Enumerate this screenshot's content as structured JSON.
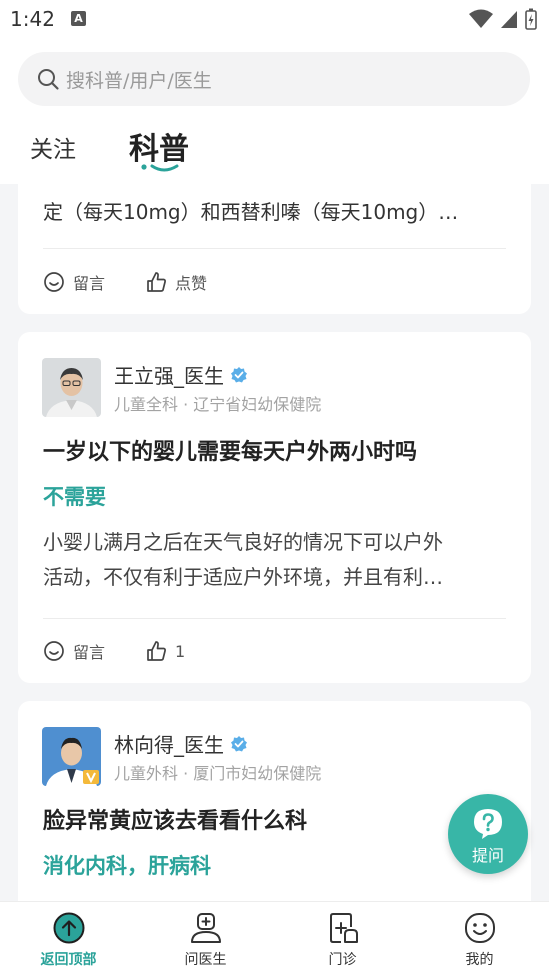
{
  "status": {
    "time": "1:42",
    "a_icon": "A"
  },
  "search": {
    "placeholder": "搜科普/用户/医生"
  },
  "tabs": {
    "follow": "关注",
    "kepu": "科普"
  },
  "card1": {
    "text": "定（每天10mg）和西替利嗪（每天10mg）…",
    "comment_label": "留言",
    "like_label": "点赞"
  },
  "card2": {
    "doctor_name": "王立强_医生",
    "department": "儿童全科 · 辽宁省妇幼保健院",
    "title": "一岁以下的婴儿需要每天户外两小时吗",
    "answer": "不需要",
    "excerpt_line1": "小婴儿满月之后在天气良好的情况下可以户外",
    "excerpt_line2": "活动，不仅有利于适应户外环境，并且有利…",
    "comment_label": "留言",
    "like_count": "1"
  },
  "card3": {
    "doctor_name": "林向得_医生",
    "department": "儿童外科 · 厦门市妇幼保健院",
    "title": "脸异常黄应该去看看什么科",
    "answer": "消化内科，肝病科"
  },
  "fab": {
    "label": "提问",
    "icon": "question-icon"
  },
  "nav": {
    "top": "返回顶部",
    "ask_doctor": "问医生",
    "clinic": "门诊",
    "mine": "我的"
  },
  "colors": {
    "accent": "#2ba39a",
    "fab": "#38b6a7"
  }
}
